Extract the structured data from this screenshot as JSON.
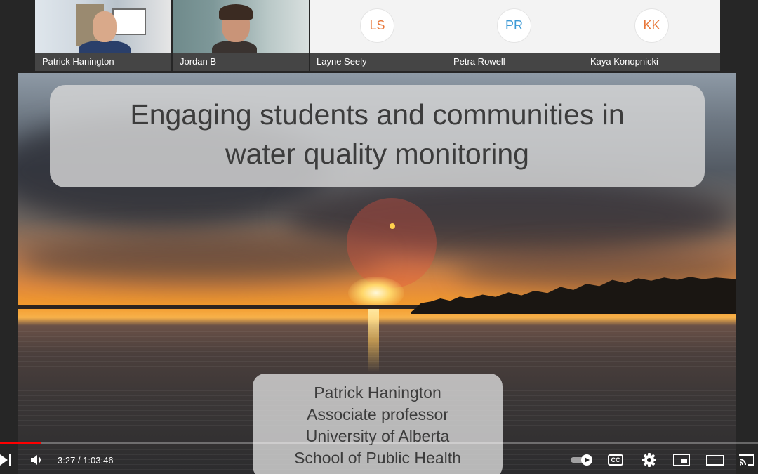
{
  "participants": [
    {
      "name": "Patrick Hanington",
      "video": true
    },
    {
      "name": "Jordan B",
      "video": true
    },
    {
      "name": "Layne Seely",
      "initials": "LS",
      "color": "#e8773a"
    },
    {
      "name": "Petra Rowell",
      "initials": "PR",
      "color": "#3d9ad6"
    },
    {
      "name": "Kaya Konopnicki",
      "initials": "KK",
      "color": "#e8773a"
    }
  ],
  "slide": {
    "title_line1": "Engaging students and communities in",
    "title_line2": "water quality monitoring",
    "author": "Patrick Hanington",
    "position": "Associate professor",
    "university": "University of Alberta",
    "school": "School of Public Health"
  },
  "player": {
    "current_time": "3:27",
    "separator": " / ",
    "duration": "1:03:46",
    "progress_fraction": 0.054,
    "accent": "#ff0000",
    "icons": [
      "next-icon",
      "volume-icon",
      "autoplay-toggle-icon",
      "captions-icon",
      "settings-icon",
      "miniplayer-icon",
      "theater-mode-icon",
      "cast-icon"
    ],
    "captions_label": "CC"
  }
}
